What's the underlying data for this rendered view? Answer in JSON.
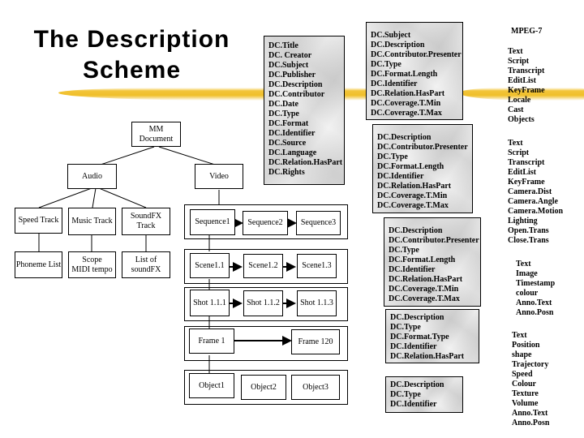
{
  "title": "The Description Scheme",
  "title_lines": [
    "The Description",
    "Scheme"
  ],
  "colors": {
    "brush_yellow": "#f2c53a",
    "line": "#000000",
    "marble": "#e2e2e2"
  },
  "tree": {
    "root": "MM\nDocument",
    "audio": "Audio",
    "video": "Video",
    "audio_children": [
      {
        "label": "Speed Track",
        "child": "Phoneme List"
      },
      {
        "label": "Music Track",
        "child": "Scope\nMIDI tempo"
      },
      {
        "label": "SoundFX\nTrack",
        "child": "List of\nsoundFX"
      }
    ],
    "sequences": [
      "Sequence1",
      "Sequence2",
      "Sequence3"
    ],
    "scenes": [
      "Scene1.1",
      "Scene1.2",
      "Scene1.3"
    ],
    "shots": [
      "Shot 1.1.1",
      "Shot 1.1.2",
      "Shot 1.1.3"
    ],
    "frames": [
      "Frame 1",
      "Frame 120"
    ],
    "objects": [
      "Object1",
      "Object2",
      "Object3"
    ]
  },
  "dc_boxes": [
    {
      "level": "document",
      "items": [
        "DC.Title",
        "DC. Creator",
        "DC.Subject",
        "DC.Publisher",
        "DC.Description",
        "DC.Contributor",
        "DC.Date",
        "DC.Type",
        "DC.Format",
        "DC.Identifier",
        "DC.Source",
        "DC.Language",
        "DC.Relation.HasPart",
        "DC.Rights"
      ]
    },
    {
      "level": "sequence",
      "items": [
        "DC.Subject",
        "DC.Description",
        "DC.Contributor.Presenter",
        "DC.Type",
        "DC.Format.Length",
        "DC.Identifier",
        "DC.Relation.HasPart",
        "DC.Coverage.T.Min",
        "DC.Coverage.T.Max"
      ]
    },
    {
      "level": "scene",
      "items": [
        "DC.Description",
        "DC.Contributor.Presenter",
        "DC.Type",
        "DC.Format.Length",
        "DC.Identifier",
        "DC.Relation.HasPart",
        "DC.Coverage.T.Min",
        "DC.Coverage.T.Max"
      ]
    },
    {
      "level": "shot",
      "items": [
        "DC.Description",
        "DC.Contributor.Presenter",
        "DC.Type",
        "DC.Format.Length",
        "DC.Identifier",
        "DC.Relation.HasPart",
        "DC.Coverage.T.Min",
        "DC.Coverage.T.Max"
      ]
    },
    {
      "level": "frame",
      "items": [
        "DC.Description",
        "DC.Type",
        "DC.Format.Type",
        "DC.Identifier",
        "DC.Relation.HasPart"
      ]
    },
    {
      "level": "object",
      "items": [
        "DC.Description",
        "DC.Type",
        "DC.Identifier"
      ]
    }
  ],
  "mpeg7": {
    "heading": "MPEG-7",
    "groups": [
      [
        "Text",
        "Script",
        "Transcript",
        "EditList",
        "KeyFrame",
        "Locale",
        "Cast",
        "Objects"
      ],
      [
        "Text",
        "Script",
        "Transcript",
        "EditList",
        "KeyFrame",
        "Camera.Dist",
        "Camera.Angle",
        "Camera.Motion",
        "Lighting",
        "Open.Trans",
        "Close.Trans"
      ],
      [
        "Text",
        "Image",
        "Timestamp",
        "colour",
        "Anno.Text",
        "Anno.Posn"
      ],
      [
        "Text",
        "Position",
        "shape",
        "Trajectory",
        "Speed",
        "Colour",
        "Texture",
        "Volume",
        "Anno.Text",
        "Anno.Posn"
      ]
    ]
  }
}
